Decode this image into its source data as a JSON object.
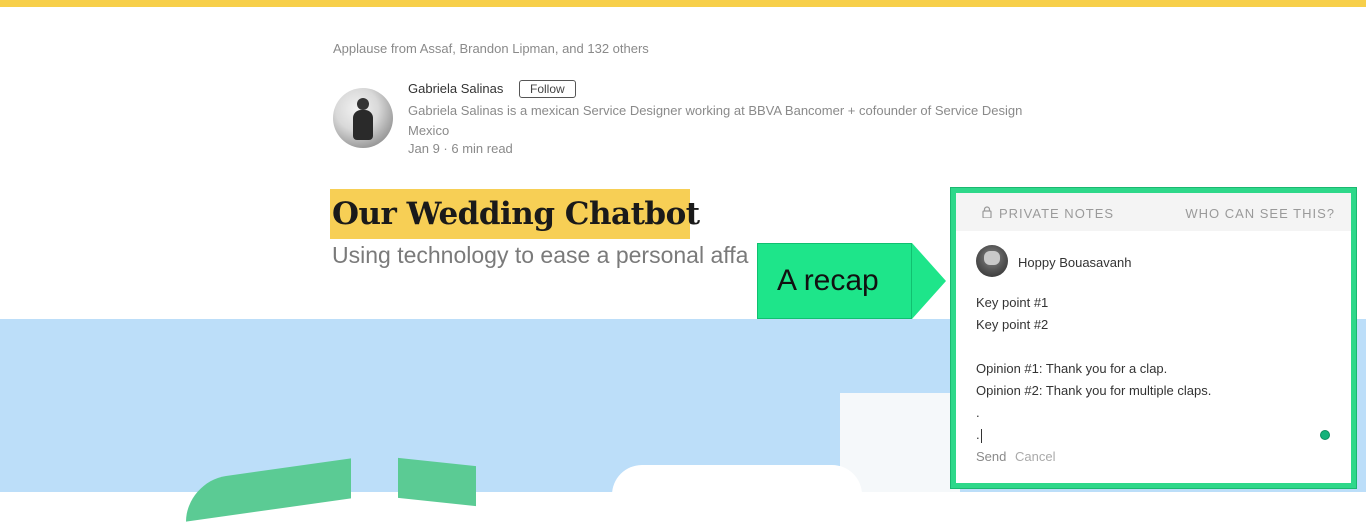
{
  "article": {
    "applause": "Applause from Assaf, Brandon Lipman, and 132 others",
    "author_name": "Gabriela Salinas",
    "follow_label": "Follow",
    "bio": "Gabriela Salinas is a mexican Service Designer working at BBVA Bancomer + cofounder of Service Design Mexico",
    "meta": "Jan 9 · 6 min read",
    "title": "Our Wedding Chatbot",
    "subtitle": "Using technology to ease a personal affa"
  },
  "callout": {
    "text": "A recap"
  },
  "notes_panel": {
    "header_label": "PRIVATE NOTES",
    "who_label": "WHO CAN SEE THIS?",
    "user_name": "Hoppy Bouasavanh",
    "lines": [
      "Key point #1",
      "Key point #2",
      "",
      "Opinion #1: Thank you for a clap.",
      "Opinion #2: Thank you for multiple claps.",
      "."
    ],
    "last_line": ".",
    "send_label": "Send",
    "cancel_label": "Cancel"
  },
  "colors": {
    "top_bar": "#f7cf4a",
    "title_highlight": "#f7cf55",
    "hero_blue": "#bcdef9",
    "accent_green": "#2ed88a",
    "callout_green": "#1ee58a"
  },
  "icons": {
    "lock": "lock-icon",
    "grammarly": "grammarly-icon"
  }
}
